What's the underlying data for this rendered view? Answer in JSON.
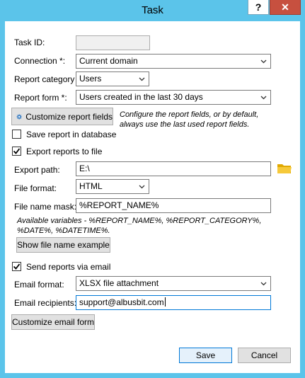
{
  "window": {
    "title": "Task",
    "help_label": "?",
    "close_label": "✕"
  },
  "form": {
    "task_id": {
      "label": "Task ID:",
      "value": ""
    },
    "connection": {
      "label": "Connection *:",
      "value": "Current domain"
    },
    "report_category": {
      "label": "Report category *:",
      "value": "Users"
    },
    "report_form": {
      "label": "Report form *:",
      "value": "Users created in the last 30 days"
    },
    "customize_report_fields": {
      "label": "Customize report fields",
      "hint": "Configure the report fields, or by default, always use the last used report fields."
    },
    "save_report_db": {
      "label": "Save report in database",
      "checked": false
    },
    "export_reports": {
      "label": "Export reports to file",
      "checked": true
    },
    "export_path": {
      "label": "Export path:",
      "value": "E:\\"
    },
    "file_format": {
      "label": "File format:",
      "value": "HTML"
    },
    "file_name_mask": {
      "label": "File name mask:",
      "value": "%REPORT_NAME%",
      "variables_hint": "Available variables - %REPORT_NAME%, %REPORT_CATEGORY%, %DATE%, %DATETIME%."
    },
    "show_example_label": "Show file name example",
    "send_email": {
      "label": "Send reports via email",
      "checked": true
    },
    "email_format": {
      "label": "Email format:",
      "value": "XLSX file attachment"
    },
    "email_recipients": {
      "label": "Email recipients:",
      "value": "support@albusbit.com"
    },
    "customize_email_label": "Customize email form"
  },
  "footer": {
    "save_label": "Save",
    "cancel_label": "Cancel"
  }
}
